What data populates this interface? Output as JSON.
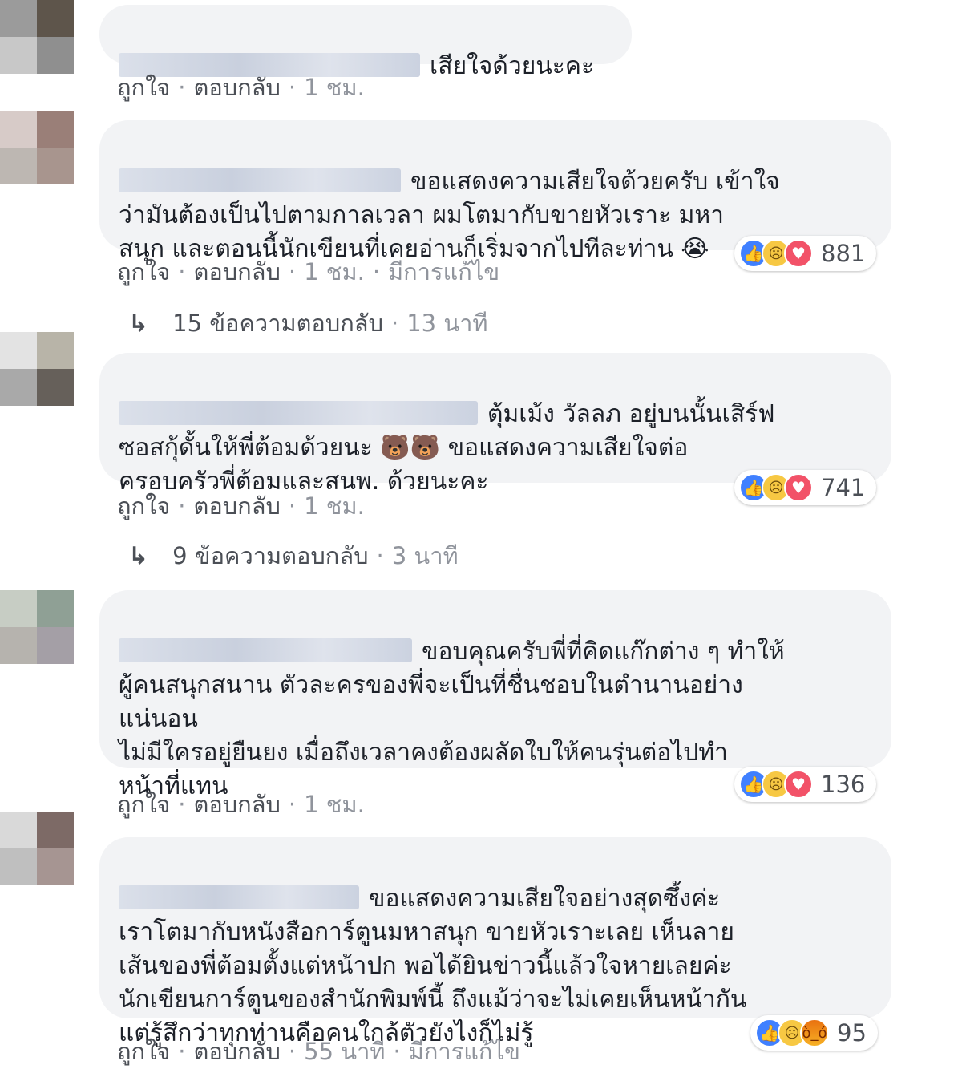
{
  "comments": [
    {
      "text": "เสียใจด้วยนะคะ",
      "like": "ถูกใจ",
      "reply": "ตอบกลับ",
      "time": "1 ชม.",
      "avatar": [
        "#9b9b9b",
        "#5e554b",
        "#c8c8c8",
        "#8f8f8f"
      ]
    },
    {
      "text": "ขอแสดงความเสียใจด้วยครับ เข้าใจ\nว่ามันต้องเป็นไปตามกาลเวลา ผมโตมากับขายหัวเราะ มหา\nสนุก และตอนนี้นักเขียนที่เคยอ่านก็เริ่มจากไปทีละท่าน 😭",
      "like": "ถูกใจ",
      "reply": "ตอบกลับ",
      "time": "1 ชม.",
      "edited": "มีการแก้ไข",
      "reactions": {
        "icons": [
          "like-icon",
          "sad-icon",
          "love-icon"
        ],
        "count": "881"
      },
      "replies": {
        "text": "15 ข้อความตอบกลับ",
        "time": "13 นาที"
      },
      "avatar": [
        "#d7cbc8",
        "#9a7f78",
        "#bdb7b2",
        "#a8958e"
      ]
    },
    {
      "text": "ตุ้มเม้ง วัลลภ อยู่บนนั้นเสิร์ฟ\nซอสกุ้ดั้นให้พี่ต้อมด้วยนะ 🐻🐻 ขอแสดงความเสียใจต่อ\nครอบครัวพี่ต้อมและสนพ. ด้วยนะคะ",
      "like": "ถูกใจ",
      "reply": "ตอบกลับ",
      "time": "1 ชม.",
      "reactions": {
        "icons": [
          "like-icon",
          "sad-icon",
          "love-icon"
        ],
        "count": "741"
      },
      "replies": {
        "text": "9 ข้อความตอบกลับ",
        "time": "3 นาที"
      },
      "avatar": [
        "#e3e3e3",
        "#b8b4a8",
        "#a9a9a9",
        "#66605a"
      ]
    },
    {
      "text": "ขอบคุณครับพี่ที่คิดแก๊กต่าง ๆ ทำให้\nผู้คนสนุกสนาน ตัวละครของพี่จะเป็นที่ชื่นชอบในตำนานอย่าง\nแน่นอน\nไม่มีใครอยู่ยืนยง เมื่อถึงเวลาคงต้องผลัดใบให้คนรุ่นต่อไปทำ\nหน้าที่แทน",
      "like": "ถูกใจ",
      "reply": "ตอบกลับ",
      "time": "1 ชม.",
      "reactions": {
        "icons": [
          "like-icon",
          "sad-icon",
          "love-icon"
        ],
        "count": "136"
      },
      "avatar": [
        "#c7cdc4",
        "#8fa095",
        "#b6b3ae",
        "#a49fa6"
      ]
    },
    {
      "text": "ขอแสดงความเสียใจอย่างสุดซึ้งค่ะ\nเราโตมากับหนังสือการ์ตูนมหาสนุก ขายหัวเราะเลย เห็นลาย\nเส้นของพี่ต้อมตั้งแต่หน้าปก พอได้ยินข่าวนี้แล้วใจหายเลยค่ะ\nนักเขียนการ์ตูนของสำนักพิมพ์นี้ ถึงแม้ว่าจะไม่เคยเห็นหน้ากัน\nแต่รู้สึกว่าทุกท่านคือคนใกล้ตัวยังไงก็ไม่รู้",
      "like": "ถูกใจ",
      "reply": "ตอบกลับ",
      "time": "55 นาที",
      "edited": "มีการแก้ไข",
      "reactions": {
        "icons": [
          "like-icon",
          "sad-icon",
          "angry-icon"
        ],
        "count": "95"
      },
      "avatar": [
        "#d9d9d9",
        "#7d6a66",
        "#bfbfbf",
        "#a69592"
      ]
    }
  ]
}
